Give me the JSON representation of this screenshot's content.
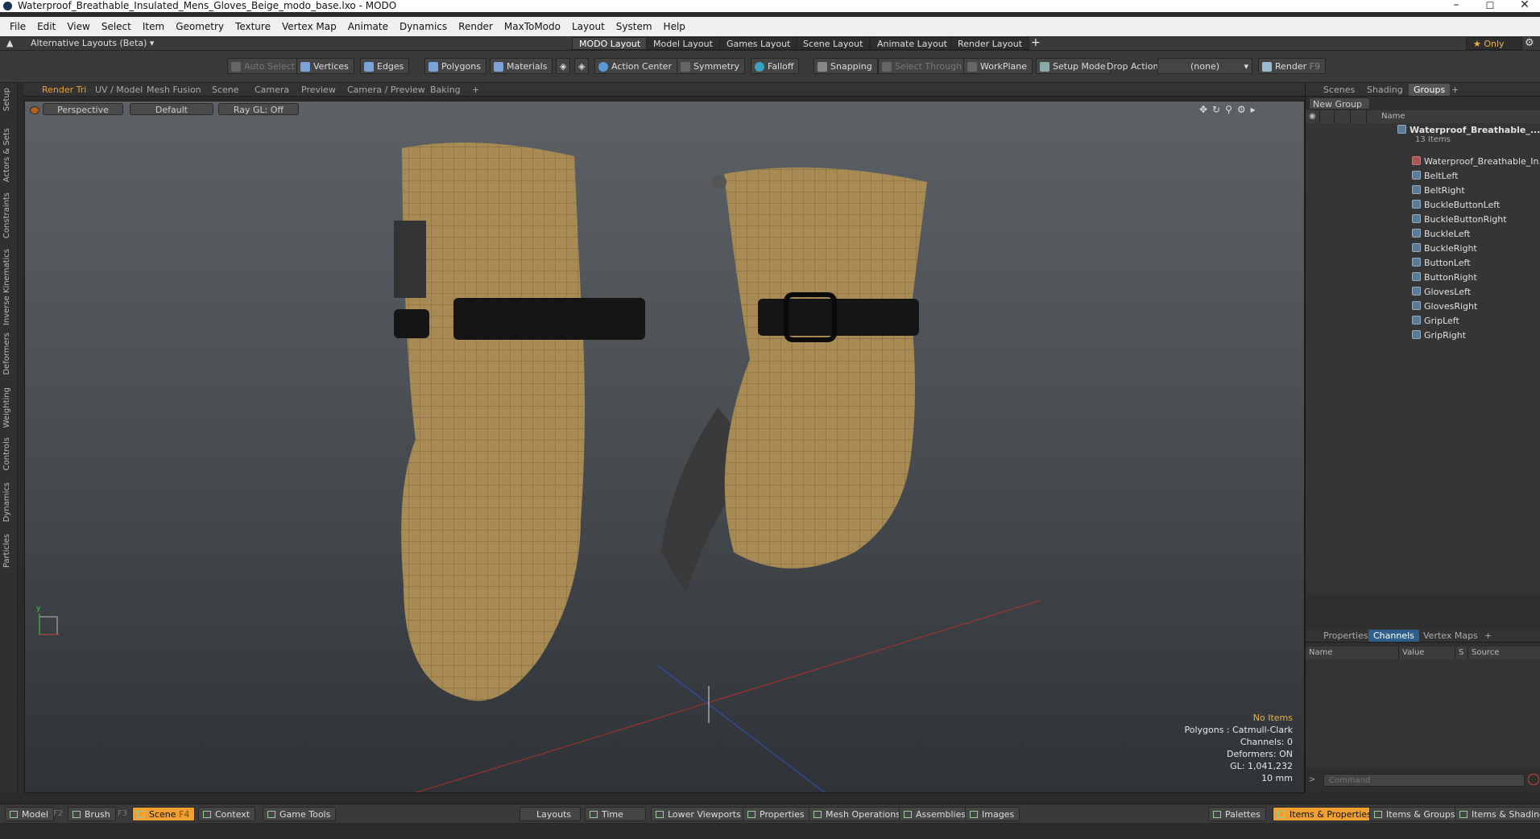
{
  "window": {
    "title": "Waterproof_Breathable_Insulated_Mens_Gloves_Beige_modo_base.lxo - MODO"
  },
  "menu": [
    "File",
    "Edit",
    "View",
    "Select",
    "Item",
    "Geometry",
    "Texture",
    "Vertex Map",
    "Animate",
    "Dynamics",
    "Render",
    "MaxToModo",
    "Layout",
    "System",
    "Help"
  ],
  "layouts": {
    "alt_label": "Alternative Layouts (Beta)",
    "tabs": [
      "MODO Layout",
      "Model Layout",
      "Games Layout",
      "Scene Layout",
      "Animate Layout",
      "Render Layout"
    ],
    "only_label": "Only"
  },
  "toolbar": {
    "auto_select": "Auto Select",
    "vertices": "Vertices",
    "edges": "Edges",
    "polygons": "Polygons",
    "materials": "Materials",
    "action_center": "Action Center",
    "symmetry": "Symmetry",
    "falloff": "Falloff",
    "snapping": "Snapping",
    "select_through": "Select Through",
    "workplane": "WorkPlane",
    "setup_mode": "Setup Mode",
    "drop_action": "Drop Action",
    "drop_value": "(none)",
    "render": "Render",
    "render_key": "F9"
  },
  "sidetabs": [
    "Setup",
    "Actors & Sets",
    "Constraints",
    "Inverse Kinematics",
    "Deformers",
    "Weighting",
    "Controls",
    "Dynamics",
    "Particles"
  ],
  "viewport_tabs": [
    "Render Tri",
    "UV / Model",
    "Mesh Fusion",
    "Scene",
    "Camera",
    "Preview",
    "Camera / Preview",
    "Baking"
  ],
  "viewport": {
    "view": "Perspective",
    "shading": "Default",
    "raygl": "Ray GL: Off",
    "info": {
      "items": "No Items",
      "polygons": "Polygons : Catmull-Clark",
      "channels": "Channels: 0",
      "deformers": "Deformers: ON",
      "gl": "GL: 1,041,232",
      "scale": "10 mm"
    }
  },
  "right_tabs": [
    "Scenes",
    "Shading",
    "Groups"
  ],
  "groups": {
    "new_group": "New Group",
    "name_header": "Name",
    "root": "Waterproof_Breathable_...",
    "root_count": "13 Items",
    "items": [
      "Waterproof_Breathable_In...",
      "BeltLeft",
      "BeltRight",
      "BuckleButtonLeft",
      "BuckleButtonRight",
      "BuckleLeft",
      "BuckleRight",
      "ButtonLeft",
      "ButtonRight",
      "GlovesLeft",
      "GlovesRight",
      "GripLeft",
      "GripRight"
    ]
  },
  "lower_tabs": [
    "Properties",
    "Channels",
    "Vertex Maps"
  ],
  "channels": {
    "name": "Name",
    "value": "Value",
    "s": "S",
    "source": "Source"
  },
  "command_placeholder": "Command",
  "bottom": {
    "model": "Model",
    "model_key": "F2",
    "brush": "Brush",
    "brush_key": "F3",
    "scene": "Scene",
    "scene_key": "F4",
    "context": "Context",
    "game_tools": "Game Tools",
    "layouts": "Layouts",
    "time": "Time",
    "lower_viewports": "Lower Viewports",
    "properties": "Properties",
    "mesh_operations": "Mesh Operations",
    "assemblies": "Assemblies",
    "images": "Images",
    "palettes": "Palettes",
    "items_properties": "Items & Properties",
    "items_groups": "Items & Groups",
    "items_shading": "Items & Shading"
  },
  "colors": {
    "accent": "#f0a030",
    "glove": "#a68a58",
    "strap": "#1a1a1a"
  }
}
